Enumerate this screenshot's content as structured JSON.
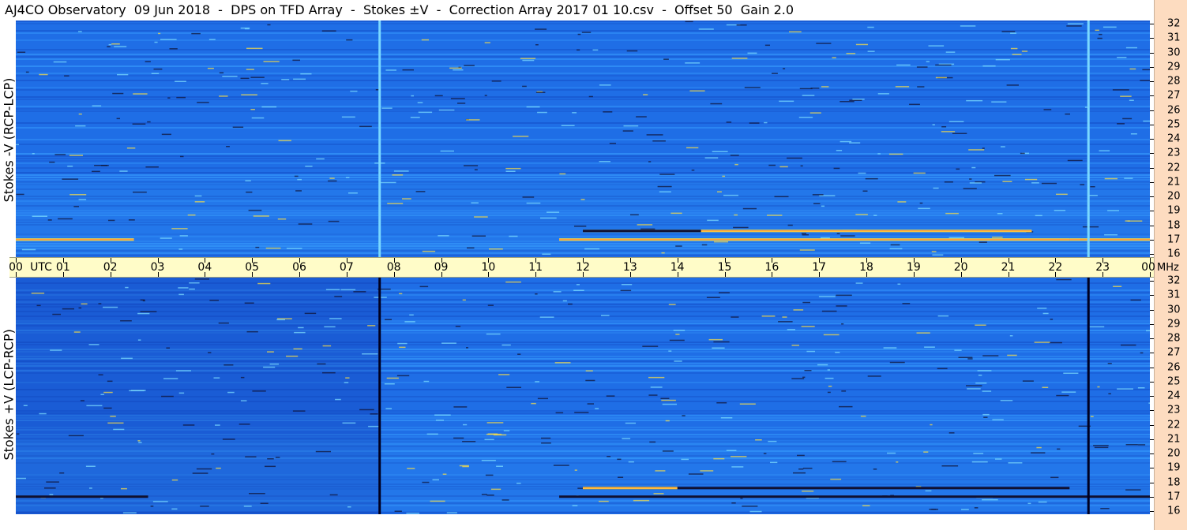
{
  "title": "AJ4CO Observatory  09 Jun 2018  -  DPS on TFD Array  -  Stokes ±V  -  Correction Array 2017 01 10.csv  -  Offset 50  Gain 2.0",
  "top_panel": {
    "label": "Stokes -V (RCP-LCP)"
  },
  "bottom_panel": {
    "label": "Stokes +V (LCP-RCP)"
  },
  "time_axis": {
    "first_label": "00",
    "unit_label": "UTC",
    "labels": [
      "01",
      "02",
      "03",
      "04",
      "05",
      "06",
      "07",
      "08",
      "09",
      "10",
      "11",
      "12",
      "13",
      "14",
      "15",
      "16",
      "17",
      "18",
      "19",
      "20",
      "21",
      "22",
      "23"
    ],
    "last_label": "00",
    "freq_unit": "MHz"
  },
  "freq_axis": {
    "labels": [
      "32",
      "31",
      "30",
      "29",
      "28",
      "27",
      "26",
      "25",
      "24",
      "23",
      "22",
      "21",
      "20",
      "19",
      "18",
      "17",
      "16"
    ],
    "min_mhz": 16,
    "max_mhz": 32
  },
  "colors": {
    "background_blue": "#1f6ee6",
    "dark_band": "#1450c8",
    "light_band": "#3aa0ff",
    "axis_fill": "#fffcc8",
    "side_fill": "#fddcc0",
    "burst_yellow": "#ffe040",
    "burst_dark": "#101030"
  },
  "spectrogram_features": {
    "top_vertical_lines_utc": [
      7.7,
      22.7
    ],
    "bottom_vertical_lines_utc": [
      7.7,
      22.7
    ],
    "top_bursts": [
      {
        "t0": 11.5,
        "t1": 22.3,
        "mhz": 17.0,
        "color": "burst_yellow"
      },
      {
        "t0": 12.0,
        "t1": 21.5,
        "mhz": 17.6,
        "color": "burst_yellow"
      },
      {
        "t0": 0.0,
        "t1": 2.5,
        "mhz": 17.0,
        "color": "burst_yellow"
      },
      {
        "t0": 22.3,
        "t1": 24.0,
        "mhz": 17.0,
        "color": "burst_yellow"
      },
      {
        "t0": 12.0,
        "t1": 14.5,
        "mhz": 17.6,
        "color": "burst_dark"
      }
    ],
    "bottom_bursts": [
      {
        "t0": 0.0,
        "t1": 2.8,
        "mhz": 17.0,
        "color": "burst_dark"
      },
      {
        "t0": 11.5,
        "t1": 24.0,
        "mhz": 17.0,
        "color": "burst_dark"
      },
      {
        "t0": 12.0,
        "t1": 22.3,
        "mhz": 17.6,
        "color": "burst_dark"
      },
      {
        "t0": 12.0,
        "t1": 14.0,
        "mhz": 17.6,
        "color": "burst_yellow"
      }
    ]
  }
}
